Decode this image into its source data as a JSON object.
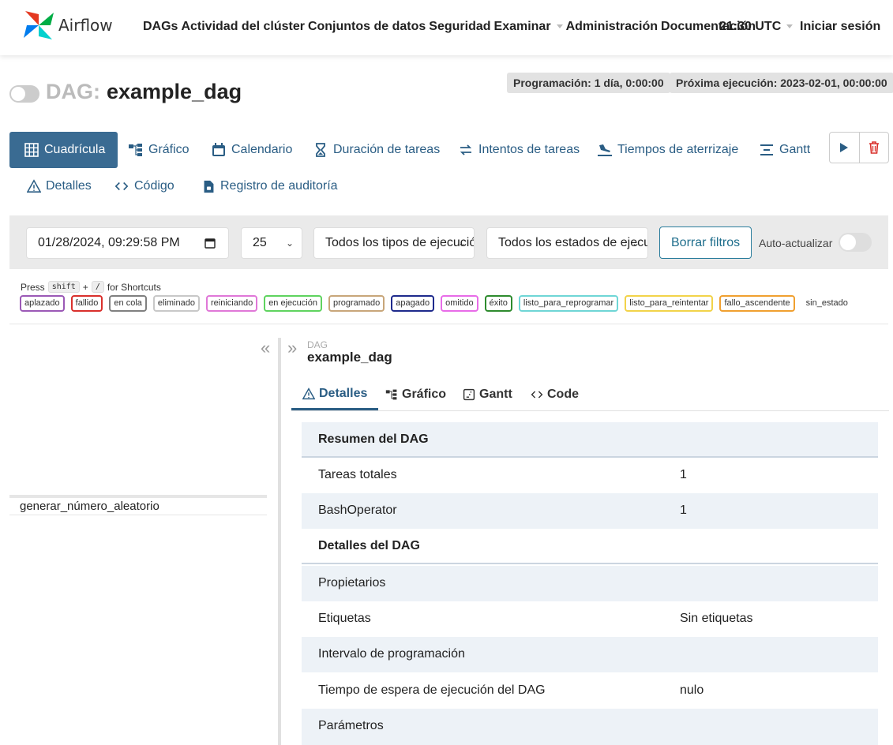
{
  "app": {
    "name": "Airflow"
  },
  "nav": {
    "items": [
      "DAGs",
      "Actividad del clúster",
      "Conjuntos de datos",
      "Seguridad",
      "Examinar",
      "Administración",
      "Documentación"
    ],
    "time": "21:30 UTC",
    "login": "Iniciar sesión"
  },
  "dag": {
    "prefix": "DAG:",
    "name": "example_dag",
    "schedule": "Programación: 1 día, 0:00:00",
    "next_run": "Próxima ejecución: 2023-02-01, 00:00:00"
  },
  "tabs": {
    "grid": "Cuadrícula",
    "graph": "Gráfico",
    "calendar": "Calendario",
    "duration": "Duración de tareas",
    "tries": "Intentos de tareas",
    "landing": "Tiempos de aterrizaje",
    "gantt": "Gantt",
    "details": "Detalles",
    "code": "Código",
    "audit": "Registro de auditoría"
  },
  "filters": {
    "datetime": "01/28/2024, 09:29:58 PM",
    "count": "25",
    "run_type": "Todos los tipos de ejecución",
    "run_state": "Todos los estados de ejecución",
    "clear": "Borrar filtros",
    "auto_refresh": "Auto-actualizar"
  },
  "shortcuts": {
    "press": "Press",
    "key1": "shift",
    "plus": "+",
    "key2": "/",
    "suffix": "for Shortcuts"
  },
  "legend": [
    {
      "label": "aplazado",
      "color": "#9b59b6"
    },
    {
      "label": "fallido",
      "color": "#d9302c"
    },
    {
      "label": "en cola",
      "color": "#808080"
    },
    {
      "label": "eliminado",
      "color": "#c8c8c8"
    },
    {
      "label": "reiniciando",
      "color": "#e078d8"
    },
    {
      "label": "en ejecución",
      "color": "#5fd35f"
    },
    {
      "label": "programado",
      "color": "#c8a67a"
    },
    {
      "label": "apagado",
      "color": "#1e2a8c"
    },
    {
      "label": "omitido",
      "color": "#e86ce8"
    },
    {
      "label": "éxito",
      "color": "#2e8b2e"
    },
    {
      "label": "listo_para_reprogramar",
      "color": "#6fd6d6"
    },
    {
      "label": "listo_para_reintentar",
      "color": "#f2d34a"
    },
    {
      "label": "fallo_ascendente",
      "color": "#f0a030"
    },
    {
      "label": "sin_estado",
      "color": ""
    }
  ],
  "tree": {
    "task": "generar_número_aleatorio"
  },
  "panel": {
    "label": "DAG",
    "name": "example_dag",
    "tabs": {
      "details": "Detalles",
      "graph": "Gráfico",
      "gantt": "Gantt",
      "code": "Code"
    }
  },
  "details": {
    "summary_header": "Resumen del DAG",
    "total_tasks_label": "Tareas totales",
    "total_tasks_value": "1",
    "bash_label": "BashOperator",
    "bash_value": "1",
    "details_header": "Detalles del DAG",
    "owners_label": "Propietarios",
    "tags_label": "Etiquetas",
    "tags_value": "Sin etiquetas",
    "interval_label": "Intervalo de programación",
    "timeout_label": "Tiempo de espera de ejecución del DAG",
    "timeout_value": "nulo",
    "params_label": "Parámetros"
  }
}
